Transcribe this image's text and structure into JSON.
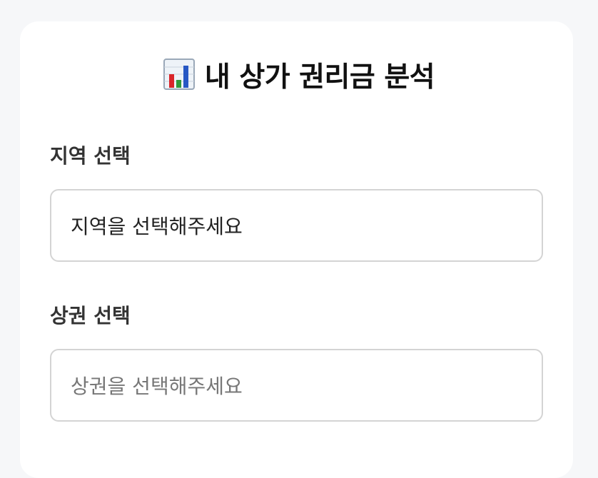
{
  "page": {
    "title": "내 상가 권리금 분석",
    "title_icon": "bar-chart-icon"
  },
  "form": {
    "region": {
      "label": "지역 선택",
      "placeholder": "지역을 선택해주세요"
    },
    "district": {
      "label": "상권 선택",
      "placeholder": "상권을 선택해주세요"
    }
  },
  "colors": {
    "background": "#f6f7f9",
    "card": "#ffffff",
    "border": "#d4d4d4",
    "icon_red": "#d9252a",
    "icon_green": "#2f9a3a",
    "icon_blue": "#2758c4"
  }
}
